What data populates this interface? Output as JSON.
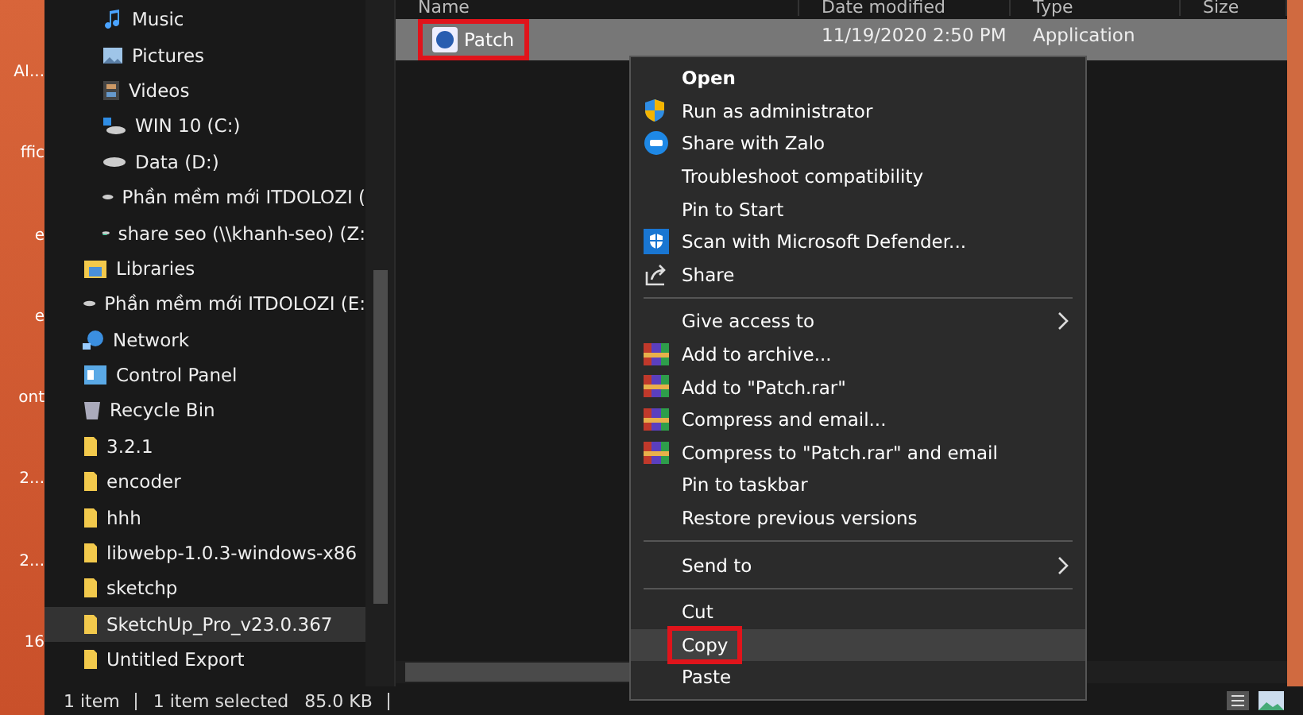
{
  "desktop": {
    "labels": [
      "AI...",
      "ffic",
      "e",
      "e",
      "ont",
      "2...",
      "2...",
      "16"
    ]
  },
  "nav": {
    "items": [
      {
        "children": [
          {
            "label": "Music",
            "kind": "music",
            "selected": false
          },
          {
            "label": "Pictures",
            "kind": "pictures",
            "selected": false
          },
          {
            "label": "Videos",
            "kind": "videos",
            "selected": false
          },
          {
            "label": "WIN 10 (C:)",
            "kind": "systemdrive",
            "selected": false
          },
          {
            "label": "Data (D:)",
            "kind": "drive",
            "selected": false
          },
          {
            "label": "Phần mềm mới ITDOLOZI (",
            "kind": "drive",
            "selected": false
          },
          {
            "label": "share seo (\\\\khanh-seo) (Z:",
            "kind": "netdrive",
            "selected": false
          }
        ]
      },
      {
        "label": "Libraries",
        "kind": "library",
        "selected": false
      },
      {
        "label": "Phần mềm mới ITDOLOZI (E:",
        "kind": "drive",
        "selected": false
      },
      {
        "label": "Network",
        "kind": "network",
        "selected": false
      },
      {
        "label": "Control Panel",
        "kind": "controlpanel",
        "selected": false
      },
      {
        "label": "Recycle Bin",
        "kind": "recycle",
        "selected": false
      },
      {
        "label": "3.2.1",
        "kind": "folder",
        "selected": false
      },
      {
        "label": "encoder",
        "kind": "folder",
        "selected": false
      },
      {
        "label": "hhh",
        "kind": "folder",
        "selected": false
      },
      {
        "label": "libwebp-1.0.3-windows-x86",
        "kind": "folder",
        "selected": false
      },
      {
        "label": "sketchp",
        "kind": "folder",
        "selected": false
      },
      {
        "label": "SketchUp_Pro_v23.0.367",
        "kind": "folder",
        "selected": true
      },
      {
        "label": "Untitled Export",
        "kind": "folder",
        "selected": false
      }
    ]
  },
  "table": {
    "columns": [
      "Name",
      "Date modified",
      "Type",
      "Size"
    ],
    "rows": [
      {
        "name": "Patch",
        "date": "11/19/2020 2:50 PM",
        "type": "Application",
        "selected": true,
        "annotated": true
      }
    ]
  },
  "context_menu": {
    "items": [
      {
        "kind": "plain",
        "label": "Open",
        "default": true,
        "selected": false
      },
      {
        "kind": "shield",
        "label": "Run as administrator",
        "selected": false
      },
      {
        "kind": "zalo",
        "label": "Share with Zalo",
        "selected": false
      },
      {
        "kind": "plain",
        "label": "Troubleshoot compatibility",
        "selected": false
      },
      {
        "kind": "plain",
        "label": "Pin to Start",
        "selected": false
      },
      {
        "kind": "defender",
        "label": "Scan with Microsoft Defender...",
        "selected": false
      },
      {
        "kind": "share",
        "label": "Share",
        "selected": false
      },
      {
        "kind": "separator"
      },
      {
        "kind": "plain",
        "label": "Give access to",
        "submenu": true,
        "selected": false
      },
      {
        "kind": "archive",
        "label": "Add to archive...",
        "selected": false
      },
      {
        "kind": "archive",
        "label": "Add to \"Patch.rar\"",
        "selected": false
      },
      {
        "kind": "archive",
        "label": "Compress and email...",
        "selected": false
      },
      {
        "kind": "archive",
        "label": "Compress to \"Patch.rar\" and email",
        "selected": false
      },
      {
        "kind": "plain",
        "label": "Pin to taskbar",
        "selected": false
      },
      {
        "kind": "plain",
        "label": "Restore previous versions",
        "selected": false
      },
      {
        "kind": "separator"
      },
      {
        "kind": "plain",
        "label": "Send to",
        "submenu": true,
        "selected": false
      },
      {
        "kind": "separator"
      },
      {
        "kind": "plain",
        "label": "Cut",
        "selected": false
      },
      {
        "kind": "plain",
        "label": "Copy",
        "selected": true,
        "annotated": true
      },
      {
        "kind": "plain",
        "label": "Paste",
        "selected": false
      }
    ]
  },
  "status_bar": {
    "count": "1 item",
    "selection": "1 item selected",
    "size": "85.0 KB"
  }
}
